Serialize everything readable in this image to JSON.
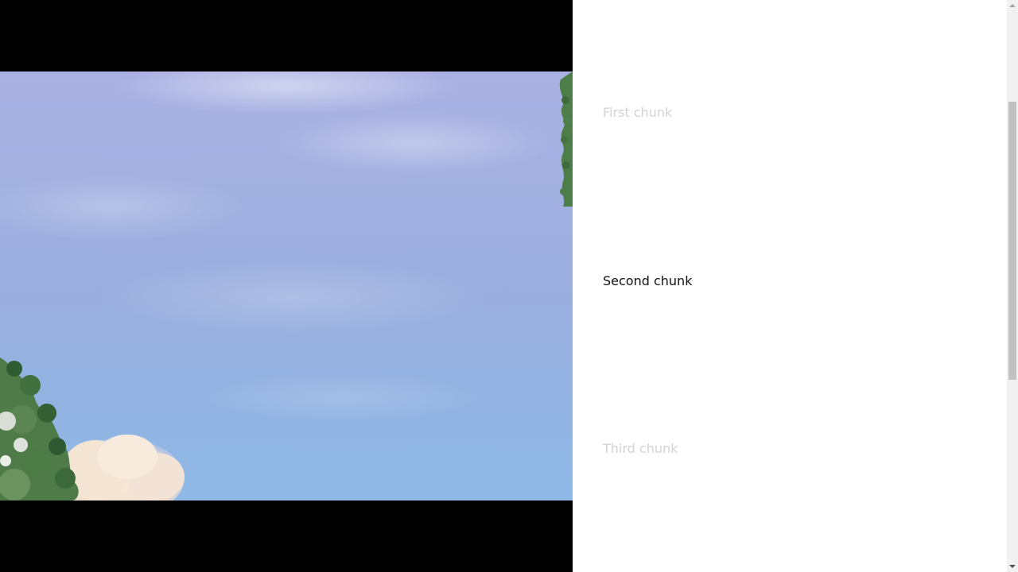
{
  "video": {
    "description_icon": "video-frame-icon"
  },
  "chunks": [
    {
      "label": "First chunk",
      "active": false
    },
    {
      "label": "Second chunk",
      "active": true
    },
    {
      "label": "Third chunk",
      "active": false
    }
  ],
  "scrollbar": {
    "position": 0.2
  }
}
